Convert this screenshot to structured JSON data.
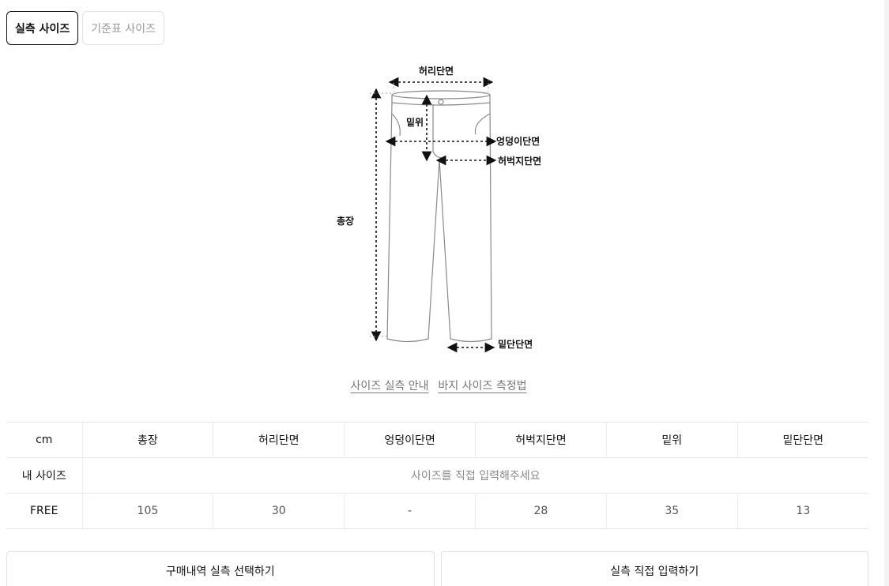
{
  "tabs": [
    {
      "label": "실측 사이즈",
      "active": true
    },
    {
      "label": "기준표 사이즈",
      "active": false
    }
  ],
  "diagram": {
    "labels": {
      "waist": "허리단면",
      "rise": "밑위",
      "hip": "엉덩이단면",
      "thigh": "허벅지단면",
      "length": "총장",
      "hem": "밑단단면"
    }
  },
  "links": {
    "size_guide": "사이즈 실측 안내",
    "pants_measure": "바지 사이즈 측정법"
  },
  "table": {
    "unit": "cm",
    "columns": [
      "총장",
      "허리단면",
      "엉덩이단면",
      "허벅지단면",
      "밑위",
      "밑단단면"
    ],
    "my_size": {
      "label": "내 사이즈",
      "prompt": "사이즈를 직접 입력해주세요"
    },
    "rows": [
      {
        "size": "FREE",
        "values": [
          "105",
          "30",
          "-",
          "28",
          "35",
          "13"
        ]
      }
    ]
  },
  "buttons": {
    "purchase_history": "구매내역 실측 선택하기",
    "direct_input": "실측 직접 입력하기"
  }
}
